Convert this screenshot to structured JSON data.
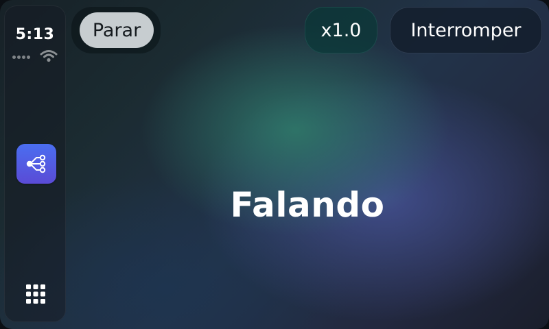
{
  "status_bar": {
    "time": "5:13",
    "signal_icon": "cellular-signal-dots-icon",
    "wifi_icon": "wifi-icon"
  },
  "sidebar": {
    "active_app_icon": "share-nodes-icon",
    "active_app_color": "#4a6ef0",
    "app_grid_icon": "app-grid-icon"
  },
  "toolbar": {
    "stop_label": "Parar",
    "speed_label": "x1.0",
    "interrupt_label": "Interromper"
  },
  "main": {
    "status_text": "Falando"
  },
  "colors": {
    "stop_button_bg": "#c7cdd0",
    "speed_button_bg": "#0b3838",
    "accent_teal": "#2e7668",
    "accent_indigo": "#465296"
  }
}
